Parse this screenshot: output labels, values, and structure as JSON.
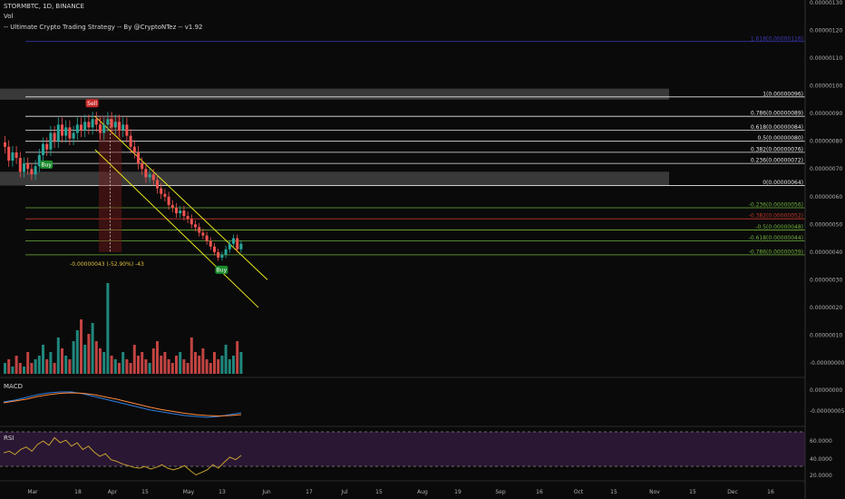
{
  "header": {
    "symbol_line": "STORMBTC, 1D, BINANCE",
    "vol_label": "Vol",
    "strategy_label": "-- Ultimate Crypto Trading Strategy -- By @CryptoNTez -- v1.92"
  },
  "colors": {
    "background": "#0a0a0a",
    "up_candle": "#26a69a",
    "down_candle": "#ef5350",
    "channel": "#e6e61a",
    "fib_white": "#e6e6e6",
    "fib_green": "#6fb03a",
    "fib_red": "#c0392b",
    "fib_blue": "#3b3bb8",
    "macd": "#2f7fe0",
    "signal": "#ff8a3d",
    "rsi": "#c7a030",
    "rsi_band": "#2a1733"
  },
  "chart_data": [
    {
      "type": "candlestick",
      "title": "STORMBTC, 1D, BINANCE",
      "xlabel": "",
      "ylabel": "",
      "x_ticks": [
        "Mar",
        "18",
        "Apr",
        "15",
        "May",
        "13",
        "Jun",
        "17",
        "Jul",
        "15",
        "Aug",
        "19",
        "Sep",
        "16",
        "Oct",
        "15",
        "Nov",
        "15",
        "Dec",
        "16"
      ],
      "y_ticks": [
        "0.00000130",
        "0.00000120",
        "0.00000110",
        "0.00000100",
        "0.00000090",
        "0.00000080",
        "0.00000070",
        "0.00000060",
        "0.00000050",
        "0.00000040",
        "0.00000030",
        "0.00000020",
        "0.00000010",
        "-0.00000000"
      ],
      "ylim": [
        -0.0,
        1.32e-06
      ],
      "grid": false,
      "close_approx": [
        7.8e-07,
        7.3e-07,
        7.6e-07,
        7.4e-07,
        6.9e-07,
        7.2e-07,
        7e-07,
        6.8e-07,
        7.1e-07,
        7.5e-07,
        7.9e-07,
        7.7e-07,
        8.3e-07,
        8e-07,
        8.6e-07,
        8.2e-07,
        8.5e-07,
        8.1e-07,
        8.3e-07,
        8.6e-07,
        8.4e-07,
        8.7e-07,
        8.5e-07,
        8.8e-07,
        8.6e-07,
        8.3e-07,
        8.6e-07,
        8.8e-07,
        8.5e-07,
        8.7e-07,
        8.4e-07,
        8.6e-07,
        8.2e-07,
        7.8e-07,
        7.6e-07,
        7.2e-07,
        7e-07,
        6.7e-07,
        6.8e-07,
        6.6e-07,
        6.3e-07,
        6.1e-07,
        6e-07,
        5.7e-07,
        5.6e-07,
        5.4e-07,
        5.5e-07,
        5.3e-07,
        5.2e-07,
        5e-07,
        4.9e-07,
        4.7e-07,
        4.6e-07,
        4.4e-07,
        4.2e-07,
        4e-07,
        3.8e-07,
        3.9e-07,
        4.1e-07,
        4.3e-07,
        4.5e-07,
        4.1e-07,
        4.3e-07
      ],
      "annotations": [
        {
          "label": "Sell",
          "at_index": 23
        },
        {
          "label": "Buy",
          "at_index": 11
        },
        {
          "label": "Buy",
          "at_index": 57
        },
        {
          "label": "-0.00000043 (-52.90%) -43"
        }
      ],
      "fib_levels": [
        {
          "label": "1.618(0.00000116)",
          "value": 1.16e-06,
          "color": "blue"
        },
        {
          "label": "1(0.00000096)",
          "value": 9.6e-07,
          "color": "white"
        },
        {
          "label": "0.786(0.00000089)",
          "value": 8.9e-07,
          "color": "white"
        },
        {
          "label": "0.618(0.00000084)",
          "value": 8.4e-07,
          "color": "white"
        },
        {
          "label": "0.5(0.00000080)",
          "value": 8e-07,
          "color": "white"
        },
        {
          "label": "0.382(0.00000076)",
          "value": 7.6e-07,
          "color": "white"
        },
        {
          "label": "0.236(0.00000072)",
          "value": 7.2e-07,
          "color": "white"
        },
        {
          "label": "0(0.00000064)",
          "value": 6.4e-07,
          "color": "white"
        },
        {
          "label": "-0.236(0.00000056)",
          "value": 5.6e-07,
          "color": "green"
        },
        {
          "label": "-0.382(0.00000052)",
          "value": 5.2e-07,
          "color": "red"
        },
        {
          "label": "-0.5(0.00000048)",
          "value": 4.8e-07,
          "color": "green"
        },
        {
          "label": "-0.618(0.00000044)",
          "value": 4.4e-07,
          "color": "green"
        },
        {
          "label": "-0.786(0.00000039)",
          "value": 3.9e-07,
          "color": "green"
        }
      ],
      "resistance_zones": [
        {
          "from": 9.5e-07,
          "to": 9.9e-07
        },
        {
          "from": 6.4e-07,
          "to": 6.9e-07
        }
      ],
      "volume": [
        3,
        4,
        2,
        5,
        3,
        2,
        6,
        3,
        4,
        5,
        8,
        4,
        6,
        3,
        10,
        7,
        5,
        4,
        9,
        12,
        15,
        8,
        11,
        14,
        9,
        7,
        6,
        25,
        5,
        4,
        3,
        6,
        4,
        3,
        8,
        5,
        6,
        4,
        3,
        7,
        9,
        5,
        6,
        4,
        3,
        5,
        6,
        4,
        3,
        10,
        6,
        5,
        7,
        4,
        3,
        6,
        4,
        5,
        8,
        4,
        5,
        9,
        6
      ]
    },
    {
      "type": "line",
      "title": "MACD",
      "y_ticks": [
        "0.00000000",
        "-0.00000005"
      ],
      "series": [
        {
          "name": "MACD",
          "values": [
            0,
            0.2,
            0.5,
            0.8,
            1.0,
            1.1,
            1.1,
            0.9,
            0.6,
            0.3,
            0.0,
            -0.3,
            -0.6,
            -0.9,
            -1.1,
            -1.3,
            -1.5,
            -1.6,
            -1.7,
            -1.6,
            -1.4,
            -1.2
          ]
        },
        {
          "name": "Signal",
          "values": [
            -0.1,
            0.1,
            0.3,
            0.6,
            0.8,
            0.95,
            1.0,
            0.95,
            0.8,
            0.55,
            0.3,
            0.0,
            -0.3,
            -0.6,
            -0.85,
            -1.05,
            -1.25,
            -1.4,
            -1.5,
            -1.55,
            -1.5,
            -1.4
          ]
        }
      ]
    },
    {
      "type": "line",
      "title": "RSI",
      "y_ticks": [
        "60.0000",
        "40.0000",
        "20.0000"
      ],
      "ylim": [
        15,
        75
      ],
      "series": [
        {
          "name": "RSI",
          "values": [
            48,
            50,
            46,
            52,
            55,
            50,
            58,
            62,
            57,
            66,
            60,
            63,
            56,
            60,
            52,
            56,
            49,
            44,
            47,
            40,
            38,
            35,
            33,
            31,
            30,
            32,
            29,
            31,
            34,
            30,
            28,
            30,
            33,
            27,
            22,
            25,
            28,
            34,
            30,
            37,
            43,
            40,
            45
          ]
        }
      ]
    }
  ]
}
